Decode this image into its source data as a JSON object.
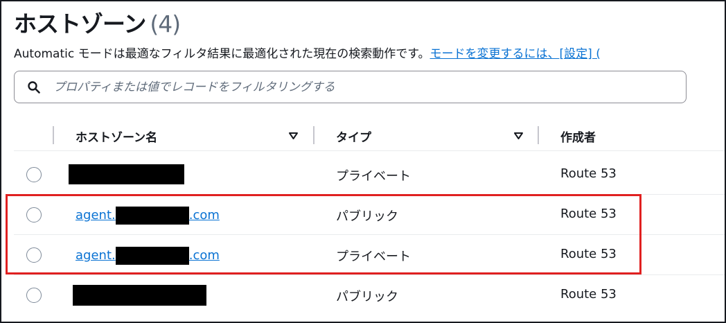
{
  "header": {
    "title": "ホストゾーン",
    "count": "(4)"
  },
  "description": {
    "text": "Automatic モードは最適なフィルタ結果に最適化された現在の検索動作です。",
    "link": "モードを変更するには、[設定] ("
  },
  "search": {
    "placeholder": "プロパティまたは値でレコードをフィルタリングする",
    "icon": "search-icon"
  },
  "table": {
    "columns": [
      {
        "label": "ホストゾーン名",
        "sortable": true
      },
      {
        "label": "タイプ",
        "sortable": true
      },
      {
        "label": "作成者",
        "sortable": false
      }
    ],
    "rows": [
      {
        "name_prefix": "",
        "name_suffix": "",
        "type": "プライベート",
        "creator": "Route 53",
        "redacted": true
      },
      {
        "name_prefix": "agent.",
        "name_suffix": ".com",
        "type": "パブリック",
        "creator": "Route 53",
        "redacted": true
      },
      {
        "name_prefix": "agent.",
        "name_suffix": ".com",
        "type": "プライベート",
        "creator": "Route 53",
        "redacted": true
      },
      {
        "name_prefix": "",
        "name_suffix": "",
        "type": "パブリック",
        "creator": "Route 53",
        "redacted": true
      }
    ]
  },
  "colors": {
    "link": "#0972d3",
    "highlight": "#e02020",
    "text": "#16191f",
    "muted": "#5f6b7a"
  }
}
